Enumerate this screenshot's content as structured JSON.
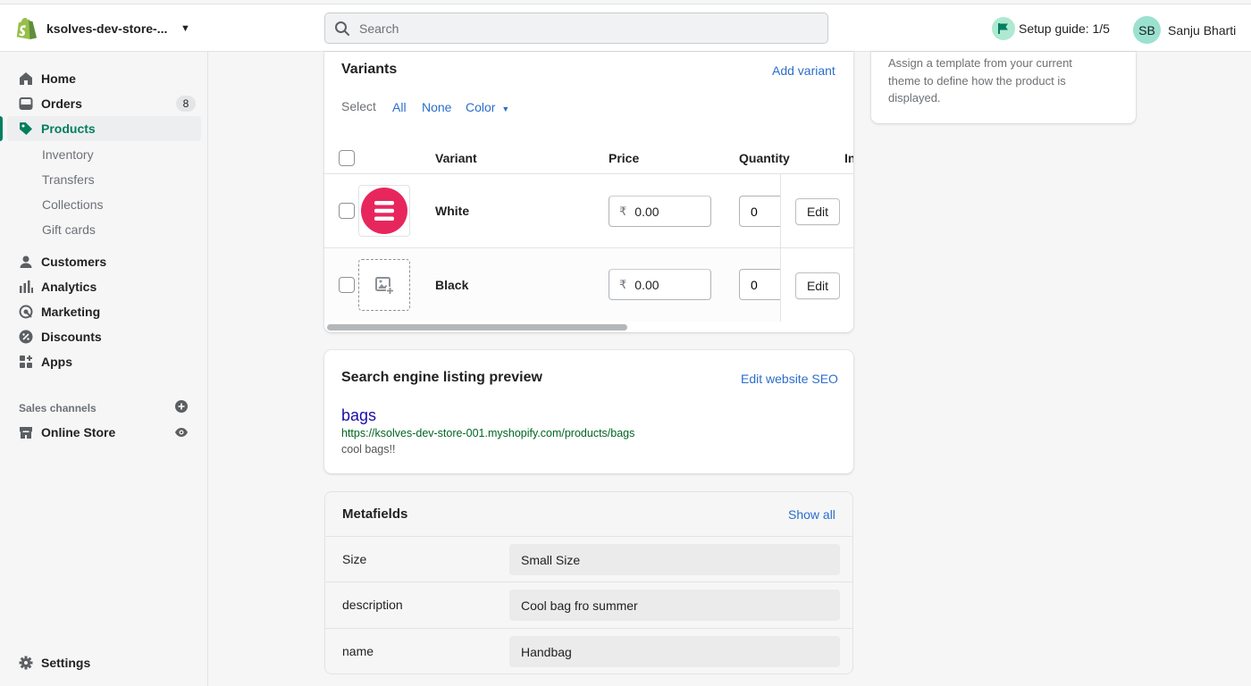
{
  "topbar": {
    "store_name": "ksolves-dev-store-...",
    "search_placeholder": "Search",
    "setup_guide": "Setup guide: 1/5",
    "user_initials": "SB",
    "user_name": "Sanju Bharti"
  },
  "sidebar": {
    "items": [
      {
        "label": "Home",
        "icon": "home-icon"
      },
      {
        "label": "Orders",
        "icon": "orders-icon",
        "badge": "8"
      },
      {
        "label": "Products",
        "icon": "tag-icon",
        "active": true
      },
      {
        "label": "Customers",
        "icon": "person-icon"
      },
      {
        "label": "Analytics",
        "icon": "analytics-icon"
      },
      {
        "label": "Marketing",
        "icon": "marketing-icon"
      },
      {
        "label": "Discounts",
        "icon": "discount-icon"
      },
      {
        "label": "Apps",
        "icon": "apps-icon"
      }
    ],
    "product_sub": [
      "Inventory",
      "Transfers",
      "Collections",
      "Gift cards"
    ],
    "sales_channels_title": "Sales channels",
    "online_store": "Online Store",
    "settings": "Settings"
  },
  "variants": {
    "title": "Variants",
    "add_variant": "Add variant",
    "select_label": "Select",
    "select_all": "All",
    "select_none": "None",
    "select_color": "Color",
    "headers": {
      "variant": "Variant",
      "price": "Price",
      "quantity": "Quantity",
      "extra": "In"
    },
    "rows": [
      {
        "name": "White",
        "currency": "₹",
        "price": "0.00",
        "quantity": "0",
        "edit": "Edit"
      },
      {
        "name": "Black",
        "currency": "₹",
        "price": "0.00",
        "quantity": "0",
        "edit": "Edit"
      }
    ]
  },
  "seo": {
    "title": "Search engine listing preview",
    "edit_link": "Edit website SEO",
    "page_title": "bags",
    "url": "https://ksolves-dev-store-001.myshopify.com/products/bags",
    "description": "cool bags!!"
  },
  "metafields": {
    "title": "Metafields",
    "show_all": "Show all",
    "rows": [
      {
        "label": "Size",
        "value": "Small Size"
      },
      {
        "label": "description",
        "value": "Cool bag fro summer"
      },
      {
        "label": "name",
        "value": "Handbag"
      }
    ]
  },
  "template_card": {
    "text": "Assign a template from your current theme to define how the product is displayed."
  },
  "colors": {
    "brand_green": "#008060",
    "link_blue": "#2c6ecb",
    "logo_pink": "#e8265e"
  }
}
